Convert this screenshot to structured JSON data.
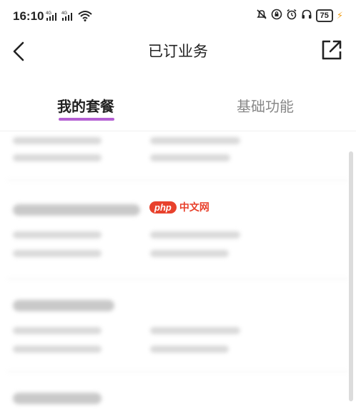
{
  "status_bar": {
    "time": "16:10",
    "network_1": "4G",
    "network_2": "4G",
    "battery": "75",
    "icons": [
      "wifi-icon",
      "bell-muted-icon",
      "lock-rotation-icon",
      "alarm-icon",
      "headphones-icon",
      "battery-icon",
      "charging-icon"
    ]
  },
  "header": {
    "title": "已订业务",
    "icons": [
      "back-arrow-icon",
      "share-external-icon"
    ]
  },
  "tabs": [
    {
      "label": "我的套餐",
      "active": true
    },
    {
      "label": "基础功能",
      "active": false
    }
  ],
  "watermark": {
    "logo": "php",
    "text": "中文网"
  },
  "colors": {
    "tab_underline": "#b45fd3",
    "watermark": "#e8412c",
    "charging": "#f0a020"
  }
}
